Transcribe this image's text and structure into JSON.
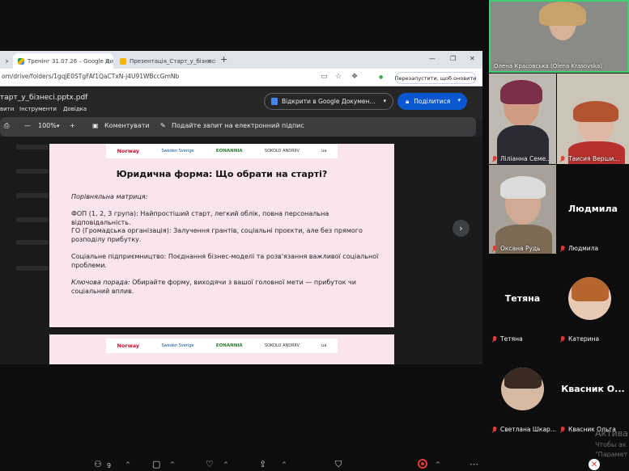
{
  "browser": {
    "tabs": [
      {
        "label": "Тренінг 31.07.26 – Google Дис"
      },
      {
        "label": "Презентація_Старт_у_бізнесі.p"
      }
    ],
    "url": "om/drive/folders/1gqjE0STgFAf1QaCTxN-j4U91WBccGmNb",
    "relaunch_label": "Перезапустити, щоб оновити"
  },
  "drive": {
    "filename": "тарт_у_бізнесі.pptx.pdf",
    "menus": [
      "вити",
      "Інструменти",
      "Довідка"
    ],
    "open_in_docs": "Відкрити в Google Докумен...",
    "share_label": "Поділитися"
  },
  "viewer": {
    "zoom": "100%",
    "comment_label": "Коментувати",
    "sign_label": "Подайте запит на електронний підпис"
  },
  "slide": {
    "logos": [
      "Norway",
      "Sweden Sverige",
      "EONANNIA",
      "SOKOLO ANDRIIV",
      "ua"
    ],
    "title": "Юридична форма: Що обрати на старті?",
    "matrix_label": "Порівняльна матриця:",
    "fop": "ФОП (1, 2, 3 група): Найпростіший старт, легкий облік, повна персональна відповідальність.",
    "go": "ГО (Громадська організація): Залучення грантів, соціальні проєкти, але без прямого розподілу прибутку.",
    "social": "Соціальне підприємництво: Поєднання бізнес-моделі та розв'язання важливої соціальної проблеми.",
    "tip": "Ключова порада: Обирайте форму, виходячи з вашої головної мети — прибуток чи соціальний вплив."
  },
  "participants": [
    {
      "name": "Олена Красовська (Olena Krasovska)",
      "muted": false
    },
    {
      "name": "Ліліанна Семе...",
      "muted": true
    },
    {
      "name": "Таисия Верши...",
      "muted": true
    },
    {
      "name": "Оксана Рудь",
      "muted": true
    },
    {
      "name": "Людмила",
      "big": "Людмила",
      "muted": true
    },
    {
      "name": "Тетяна",
      "big": "Тетяна",
      "muted": true
    },
    {
      "name": "Катерина",
      "muted": true
    },
    {
      "name": "Светлана Шкар...",
      "muted": true
    },
    {
      "name": "Квасник Ольга",
      "big": "Квасник О...",
      "muted": true
    }
  ],
  "watermark": {
    "line1": "Актива",
    "line2": "Чтобы ак",
    "line3": "\"Парамет"
  },
  "toolbar": {
    "participants_count": "9"
  },
  "colors": {
    "slide_bg": "#fae5ee",
    "share_button": "#0b57d0",
    "record": "#e53935"
  }
}
